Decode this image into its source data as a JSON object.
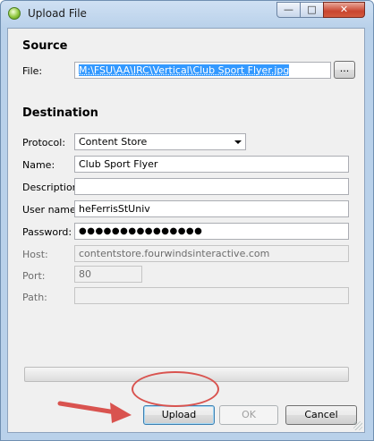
{
  "window": {
    "title": "Upload File",
    "min_glyph": "—",
    "max_glyph": "□",
    "close_glyph": "✕"
  },
  "source": {
    "heading": "Source",
    "file_label": "File:",
    "file_value": "M:\\FSU\\AA\\IRC\\Vertical\\Club Sport Flyer.jpg",
    "browse_label": "..."
  },
  "destination": {
    "heading": "Destination",
    "protocol_label": "Protocol:",
    "protocol_value": "Content Store",
    "name_label": "Name:",
    "name_value": "Club Sport Flyer",
    "description_label": "Description:",
    "description_value": "",
    "username_label": "User name:",
    "username_value": "heFerrisStUniv",
    "password_label": "Password:",
    "password_value": "●●●●●●●●●●●●●●●",
    "host_label": "Host:",
    "host_value": "contentstore.fourwindsinteractive.com",
    "port_label": "Port:",
    "port_value": "80",
    "path_label": "Path:",
    "path_value": ""
  },
  "progress": {
    "value": 0
  },
  "buttons": {
    "upload": "Upload",
    "ok": "OK",
    "cancel": "Cancel"
  },
  "colors": {
    "annotation": "#d9534f",
    "selection": "#3399ff"
  },
  "icons": [
    "app-icon",
    "minimize-icon",
    "maximize-icon",
    "close-icon",
    "chevron-down-icon",
    "arrow-annotation-icon"
  ]
}
